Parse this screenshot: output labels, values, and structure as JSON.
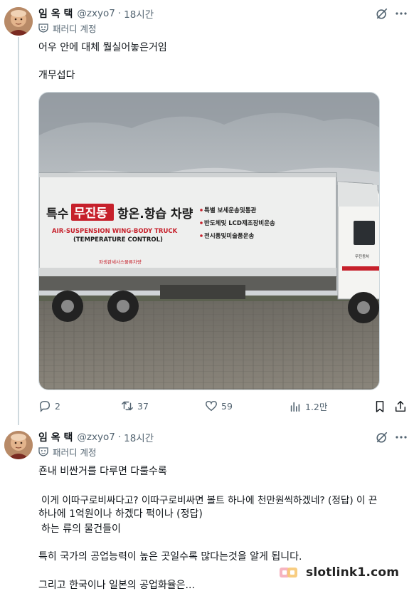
{
  "colors": {
    "secondary_text": "#536471",
    "thread_line": "#cfd9de",
    "primary_text": "#0f1419"
  },
  "tweet1": {
    "author_name": "임 옥 택",
    "handle": "@zxyo7",
    "separator": "·",
    "time": "18시간",
    "parody_label": "패러디 계정",
    "lines": [
      "어우 안에 대체 뭘실어놓은거임",
      "개무섭다"
    ],
    "photo": {
      "truck_text": {
        "brand_prefix": "특수",
        "brand_box": "무진동",
        "brand_suffix": "항온.항습 차량",
        "english_1": "AIR-SUSPENSION WING-BODY TRUCK",
        "english_2": "(TEMPERATURE CONTROL)",
        "bullet_1": "특별 보세운송및통관",
        "bullet_2": "반도체및 LCD제조장비운송",
        "bullet_3": "전시품및미술품운송",
        "small_red": "파생관세사스물류차량",
        "cab_text": "무진동차"
      }
    },
    "actions": {
      "replies": "2",
      "retweets": "37",
      "likes": "59",
      "views": "1.2만"
    }
  },
  "tweet2": {
    "author_name": "임 옥 택",
    "handle": "@zxyo7",
    "separator": "·",
    "time": "18시간",
    "parody_label": "패러디 계정",
    "lines": [
      "죤내 비싼거를 다루면 다룰수록",
      "이게 이따구로비싸다고? 이따구로비싸면 볼트 하나에 천만원씩하겠네? (정답) 이 끈",
      "하나에 1억원이나 하겠다 퍽이나 (정답)",
      "하는 류의 물건들이",
      "특히 국가의 공업능력이 높은 곳일수록 많다는것을 알게 됩니다.",
      "그리고 한국이나 일본의 공업화율은..."
    ]
  },
  "watermark": {
    "text": "slotlink1.com"
  }
}
